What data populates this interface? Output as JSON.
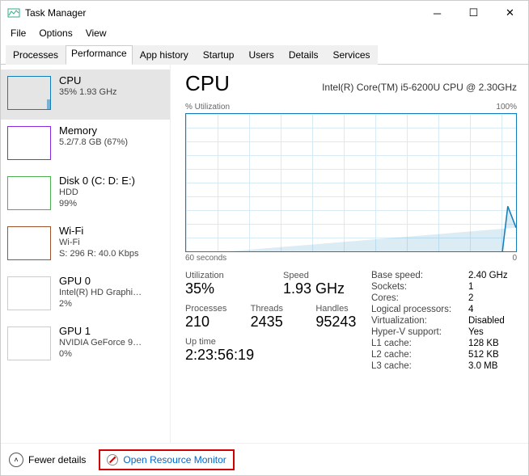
{
  "window": {
    "title": "Task Manager"
  },
  "menu": {
    "file": "File",
    "options": "Options",
    "view": "View"
  },
  "tabs": {
    "processes": "Processes",
    "performance": "Performance",
    "app_history": "App history",
    "startup": "Startup",
    "users": "Users",
    "details": "Details",
    "services": "Services"
  },
  "sidebar": [
    {
      "name": "CPU",
      "sub1": "35%  1.93 GHz",
      "sub2": "",
      "color": "#117dbb"
    },
    {
      "name": "Memory",
      "sub1": "5.2/7.8 GB (67%)",
      "sub2": "",
      "color": "#8a2be2"
    },
    {
      "name": "Disk 0 (C: D: E:)",
      "sub1": "HDD",
      "sub2": "99%",
      "color": "#4caf50"
    },
    {
      "name": "Wi-Fi",
      "sub1": "Wi-Fi",
      "sub2": "S: 296  R: 40.0 Kbps",
      "color": "#a0522d"
    },
    {
      "name": "GPU 0",
      "sub1": "Intel(R) HD Graphi…",
      "sub2": "2%",
      "color": "#117dbb"
    },
    {
      "name": "GPU 1",
      "sub1": "NVIDIA GeForce 9…",
      "sub2": "0%",
      "color": "#117dbb"
    }
  ],
  "main": {
    "title": "CPU",
    "model": "Intel(R) Core(TM) i5-6200U CPU @ 2.30GHz",
    "y_label": "% Utilization",
    "y_max": "100%",
    "x_left": "60 seconds",
    "x_right": "0"
  },
  "stats": {
    "utilization_label": "Utilization",
    "utilization": "35%",
    "speed_label": "Speed",
    "speed": "1.93 GHz",
    "processes_label": "Processes",
    "processes": "210",
    "threads_label": "Threads",
    "threads": "2435",
    "handles_label": "Handles",
    "handles": "95243",
    "uptime_label": "Up time",
    "uptime": "2:23:56:19"
  },
  "details": {
    "base_speed_l": "Base speed:",
    "base_speed": "2.40 GHz",
    "sockets_l": "Sockets:",
    "sockets": "1",
    "cores_l": "Cores:",
    "cores": "2",
    "lproc_l": "Logical processors:",
    "lproc": "4",
    "virt_l": "Virtualization:",
    "virt": "Disabled",
    "hyperv_l": "Hyper-V support:",
    "hyperv": "Yes",
    "l1_l": "L1 cache:",
    "l1": "128 KB",
    "l2_l": "L2 cache:",
    "l2": "512 KB",
    "l3_l": "L3 cache:",
    "l3": "3.0 MB"
  },
  "footer": {
    "fewer": "Fewer details",
    "orm": "Open Resource Monitor"
  },
  "chart_data": {
    "type": "line",
    "title": "% Utilization",
    "xlabel": "60 seconds",
    "ylabel": "% Utilization",
    "ylim": [
      0,
      100
    ],
    "x_seconds": [
      60,
      55,
      50,
      45,
      40,
      35,
      30,
      25,
      20,
      15,
      10,
      5,
      0
    ],
    "values": [
      0,
      0,
      0,
      0,
      0,
      0,
      0,
      0,
      0,
      0,
      0,
      0,
      35
    ]
  }
}
